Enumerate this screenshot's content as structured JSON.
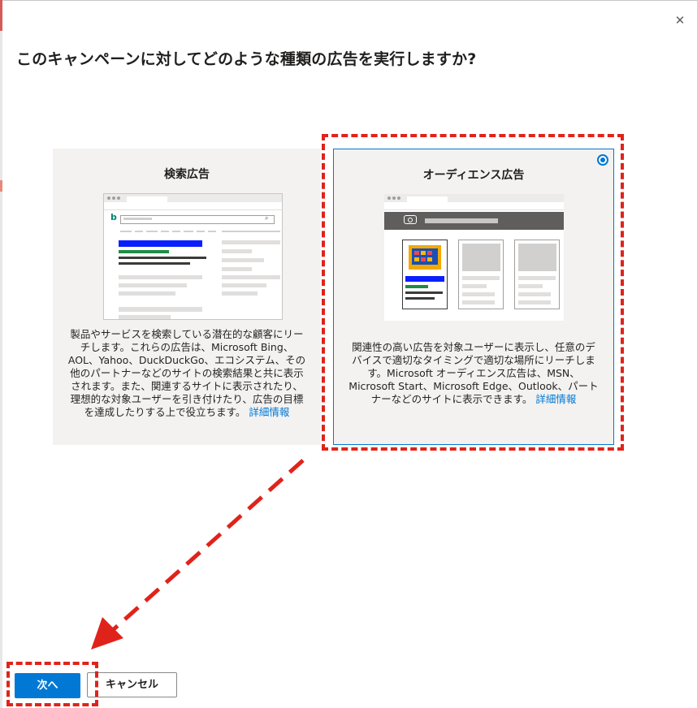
{
  "dialog": {
    "title": "このキャンペーンに対してどのような種類の広告を実行しますか?",
    "close_symbol": "✕"
  },
  "cards": [
    {
      "title": "検索広告",
      "description": "製品やサービスを検索している潜在的な顧客にリーチします。これらの広告は、Microsoft Bing、AOL、Yahoo、DuckDuckGo、エコシステム、その他のパートナーなどのサイトの検索結果と共に表示されます。また、関連するサイトに表示されたり、理想的な対象ユーザーを引き付けたり、広告の目標を達成したりする上で役立ちます。",
      "link": "詳細情報",
      "selected": false
    },
    {
      "title": "オーディエンス広告",
      "description": "関連性の高い広告を対象ユーザーに表示し、任意のデバイスで適切なタイミングで適切な場所にリーチします。Microsoft オーディエンス広告は、MSN、Microsoft Start、Microsoft Edge、Outlook、パートナーなどのサイトに表示できます。",
      "link": "詳細情報",
      "selected": true
    }
  ],
  "footer": {
    "next_label": "次へ",
    "cancel_label": "キャンセル"
  },
  "colors": {
    "accent": "#0078d4",
    "annotation": "#e0231a"
  }
}
